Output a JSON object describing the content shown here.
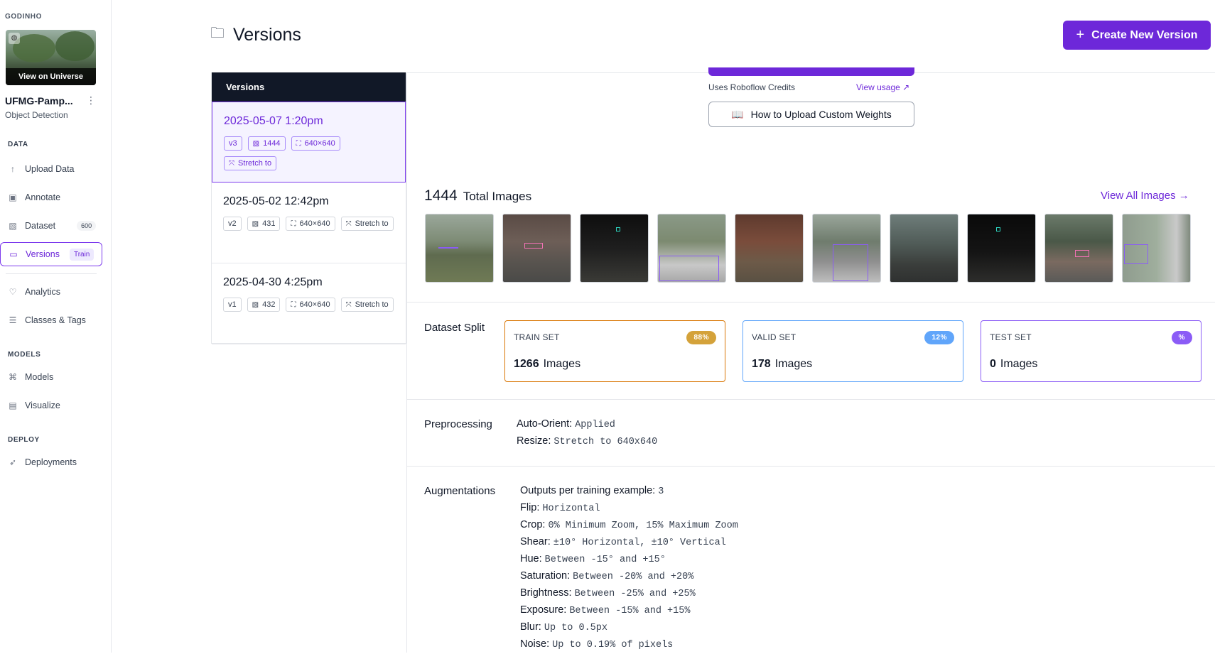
{
  "sidebar": {
    "workspace": "GODINHO",
    "universe_label": "View on Universe",
    "project_name": "UFMG-Pamp...",
    "project_type": "Object Detection",
    "sections": {
      "data": "DATA",
      "models": "MODELS",
      "deploy": "DEPLOY"
    },
    "items": {
      "upload": "Upload Data",
      "annotate": "Annotate",
      "dataset": "Dataset",
      "dataset_count": "600",
      "versions": "Versions",
      "versions_badge": "Train",
      "analytics": "Analytics",
      "classes": "Classes & Tags",
      "models": "Models",
      "visualize": "Visualize",
      "deployments": "Deployments"
    }
  },
  "header": {
    "title": "Versions",
    "create_button": "Create New Version"
  },
  "versions": {
    "heading": "Versions",
    "items": [
      {
        "date": "2025-05-07 1:20pm",
        "version": "v3",
        "images": "1444",
        "size": "640×640",
        "resize": "Stretch to"
      },
      {
        "date": "2025-05-02 12:42pm",
        "version": "v2",
        "images": "431",
        "size": "640×640",
        "resize": "Stretch to"
      },
      {
        "date": "2025-04-30 4:25pm",
        "version": "v1",
        "images": "432",
        "size": "640×640",
        "resize": "Stretch to"
      }
    ]
  },
  "detail": {
    "credits_text": "Uses Roboflow Credits",
    "view_usage": "View usage ↗",
    "weights_button": "How to Upload Custom Weights",
    "total_count": "1444",
    "total_label": "Total Images",
    "view_all": "View All Images →",
    "split_label": "Dataset Split",
    "split": {
      "train": {
        "name": "TRAIN SET",
        "pct": "88%",
        "count": "1266",
        "unit": "Images"
      },
      "valid": {
        "name": "VALID SET",
        "pct": "12%",
        "count": "178",
        "unit": "Images"
      },
      "test": {
        "name": "TEST SET",
        "pct": "%",
        "count": "0",
        "unit": "Images"
      }
    },
    "preprocessing_label": "Preprocessing",
    "preprocessing": [
      {
        "key": "Auto-Orient:",
        "value": "Applied"
      },
      {
        "key": "Resize:",
        "value": "Stretch to 640x640"
      }
    ],
    "augmentations_label": "Augmentations",
    "augmentations": [
      {
        "key": "Outputs per training example:",
        "value": "3"
      },
      {
        "key": "Flip:",
        "value": "Horizontal"
      },
      {
        "key": "Crop:",
        "value": "0% Minimum Zoom, 15% Maximum Zoom"
      },
      {
        "key": "Shear:",
        "value": "±10° Horizontal, ±10° Vertical"
      },
      {
        "key": "Hue:",
        "value": "Between -15° and +15°"
      },
      {
        "key": "Saturation:",
        "value": "Between -20% and +20%"
      },
      {
        "key": "Brightness:",
        "value": "Between -25% and +25%"
      },
      {
        "key": "Exposure:",
        "value": "Between -15% and +15%"
      },
      {
        "key": "Blur:",
        "value": "Up to 0.5px"
      },
      {
        "key": "Noise:",
        "value": "Up to 0.19% of pixels"
      }
    ]
  },
  "colors": {
    "accent": "#6d28d9",
    "train": "#d4a23a",
    "valid": "#60a5fa",
    "test": "#8b5cf6"
  }
}
